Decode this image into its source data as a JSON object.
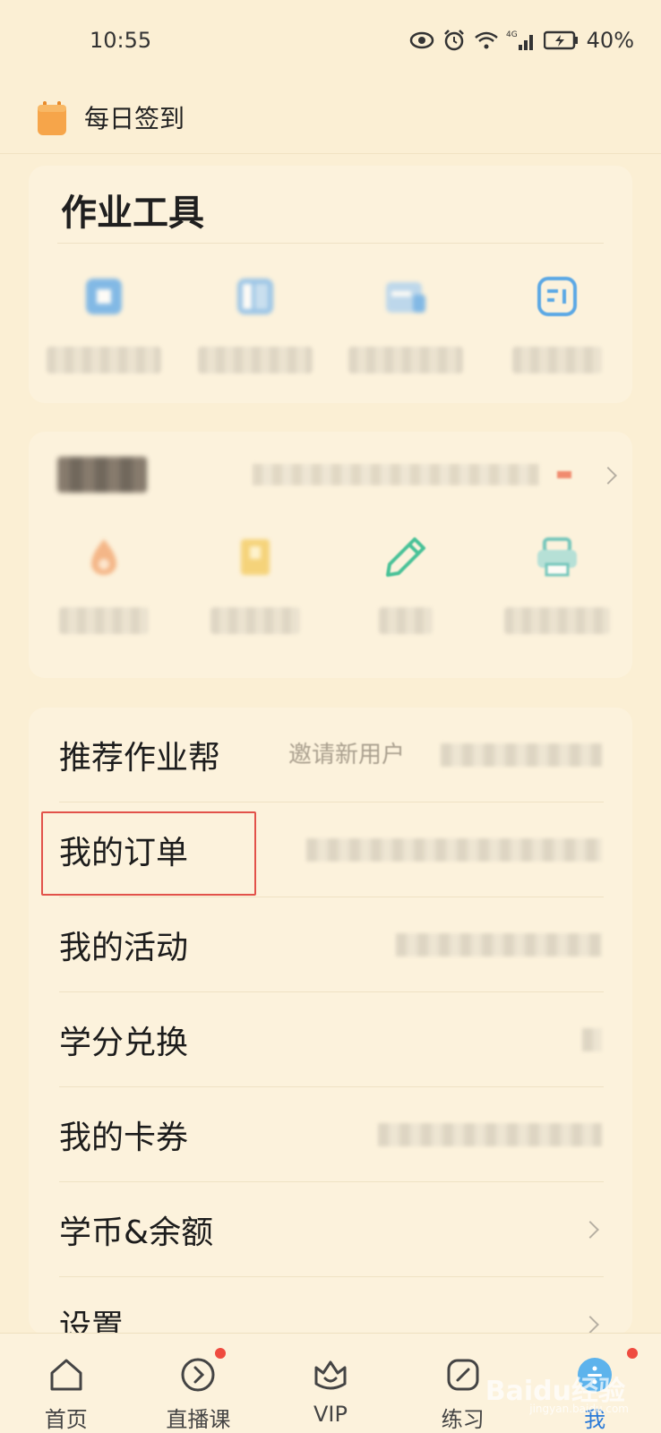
{
  "status_bar": {
    "time": "10:55",
    "network": "4G",
    "battery": "40%",
    "icons": [
      "eye-icon",
      "alarm-icon",
      "wifi-icon",
      "signal-icon",
      "battery-icon"
    ]
  },
  "header": {
    "checkin_label": "每日签到",
    "icon": "calendar-checkin-icon"
  },
  "tools": {
    "title": "作业工具",
    "items": [
      {
        "icon": "tool-icon-1",
        "color": "#5aa6e8"
      },
      {
        "icon": "tool-icon-2",
        "color": "#5aa6e8"
      },
      {
        "icon": "tool-icon-3",
        "color": "#5aa6e8"
      },
      {
        "icon": "tool-icon-4",
        "color": "#4aa0e6"
      }
    ]
  },
  "mall": {
    "items": [
      {
        "icon": "mall-icon-1",
        "color": "#f2a36c"
      },
      {
        "icon": "mall-icon-2",
        "color": "#f3c95a"
      },
      {
        "icon": "pen-icon",
        "color": "#3fbf94"
      },
      {
        "icon": "printer-icon",
        "color": "#46b7b0"
      }
    ]
  },
  "menu": {
    "items": [
      {
        "label": "推荐作业帮",
        "hint": "邀请新用户"
      },
      {
        "label": "我的订单",
        "hint": ""
      },
      {
        "label": "我的活动",
        "hint": ""
      },
      {
        "label": "学分兑换",
        "hint": ""
      },
      {
        "label": "我的卡券",
        "hint": ""
      },
      {
        "label": "学币&余额",
        "hint": ""
      },
      {
        "label": "设置",
        "hint": ""
      }
    ]
  },
  "bottom_nav": {
    "items": [
      {
        "label": "首页",
        "icon": "home-icon"
      },
      {
        "label": "直播课",
        "icon": "live-play-icon"
      },
      {
        "label": "VIP",
        "icon": "vip-crown-icon"
      },
      {
        "label": "练习",
        "icon": "practice-pen-icon"
      },
      {
        "label": "我",
        "icon": "profile-icon"
      }
    ],
    "active_color": "#2a7ad8"
  },
  "watermark": {
    "text": "Baidu经验",
    "sub": "jingyan.baidu.com"
  }
}
